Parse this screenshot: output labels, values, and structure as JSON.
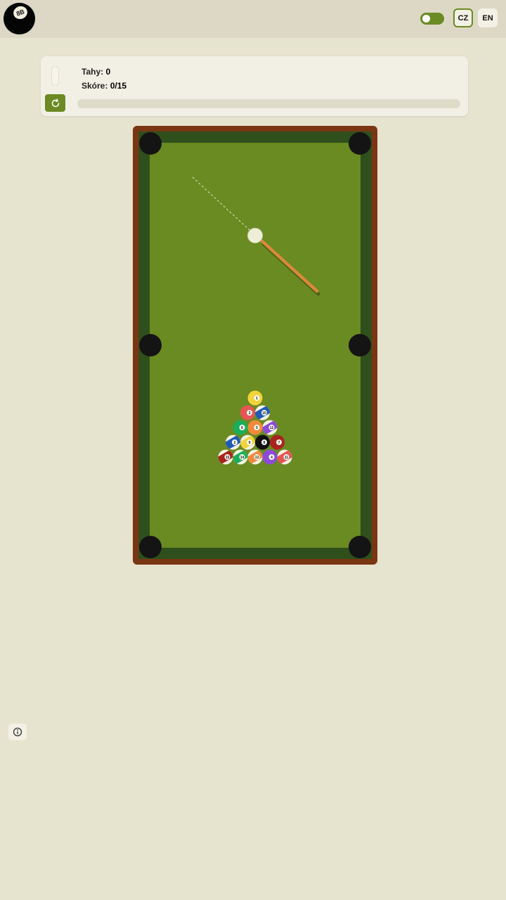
{
  "header": {
    "logo_text": "8B",
    "toggle_on": true,
    "languages": [
      {
        "label": "CZ",
        "active": true
      },
      {
        "label": "EN",
        "active": false
      }
    ]
  },
  "stats": {
    "moves_label": "Tahy:",
    "moves_value": "0",
    "score_label": "Skóre:",
    "score_value": "0/15",
    "progress": 0
  },
  "colors": {
    "accent": "#6b8a23",
    "felt": "#6a8a22",
    "cushion": "#2f4f1c",
    "rail": "#7a3612",
    "background": "#e6e3cf"
  },
  "balls": [
    {
      "number": 1,
      "color": "#f2d33a",
      "stripe": false
    },
    {
      "number": 3,
      "color": "#e85555",
      "stripe": false
    },
    {
      "number": 10,
      "color": "#1f5bb5",
      "stripe": true
    },
    {
      "number": 6,
      "color": "#1bae5a",
      "stripe": false
    },
    {
      "number": 5,
      "color": "#f08a3a",
      "stripe": false
    },
    {
      "number": 12,
      "color": "#8d4ad8",
      "stripe": true
    },
    {
      "number": 2,
      "color": "#1f5bb5",
      "stripe": true
    },
    {
      "number": 9,
      "color": "#f2d33a",
      "stripe": true
    },
    {
      "number": 8,
      "color": "#111111",
      "stripe": false
    },
    {
      "number": 7,
      "color": "#a8241e",
      "stripe": false
    },
    {
      "number": 15,
      "color": "#a8241e",
      "stripe": true
    },
    {
      "number": 14,
      "color": "#1bae5a",
      "stripe": true
    },
    {
      "number": 13,
      "color": "#f08a3a",
      "stripe": true
    },
    {
      "number": 4,
      "color": "#8d4ad8",
      "stripe": false
    },
    {
      "number": 11,
      "color": "#e85555",
      "stripe": true
    }
  ]
}
